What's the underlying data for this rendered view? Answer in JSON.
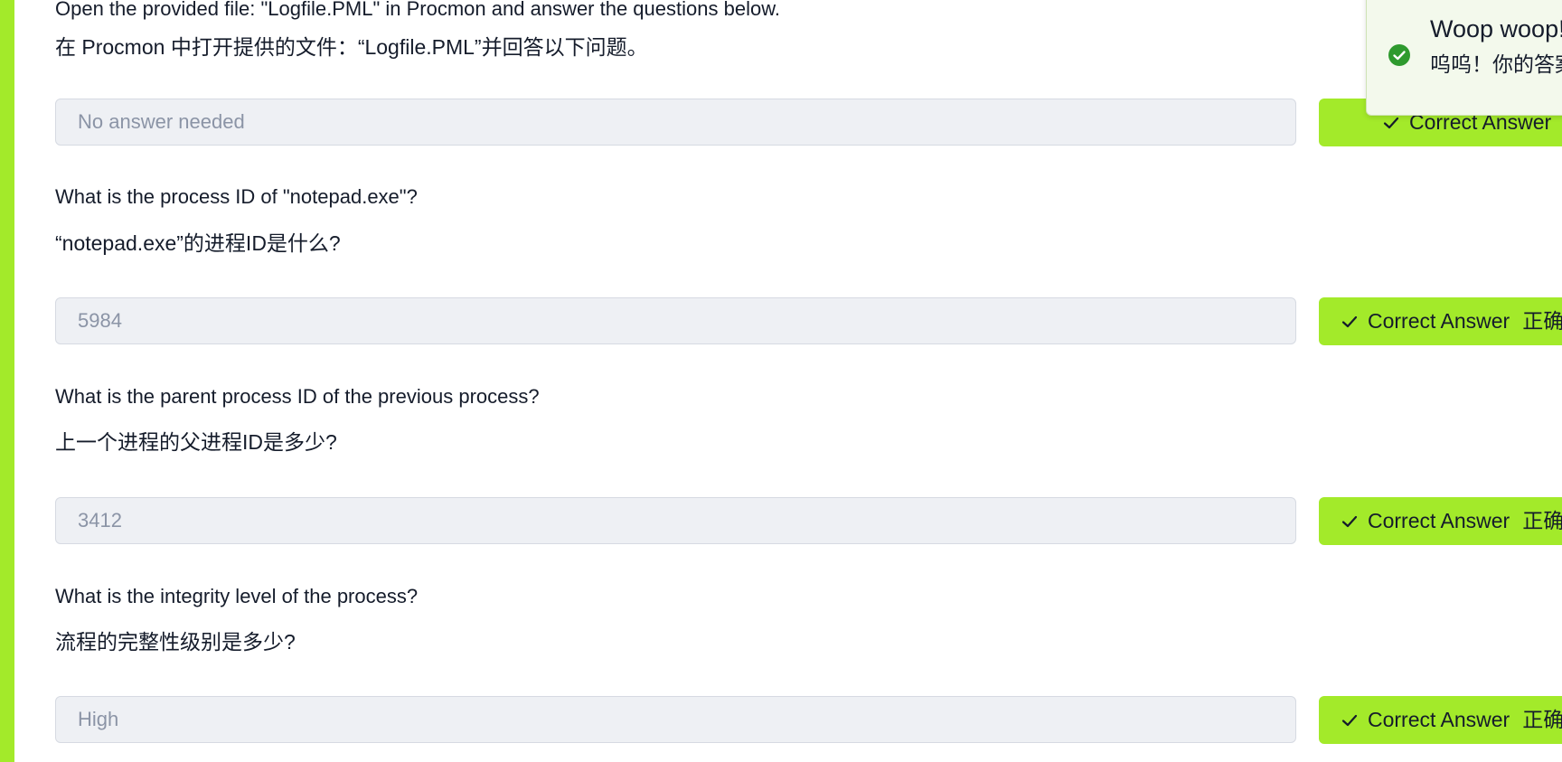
{
  "questions": [
    {
      "text_en": "Open the provided file: \"Logfile.PML\" in Procmon and answer the questions below.",
      "text_zh": "在 Procmon 中打开提供的文件：“Logfile.PML”并回答以下问题。",
      "answer": "No answer needed",
      "button_label": "Correct Answer",
      "button_label_zh": ""
    },
    {
      "text_en": "What is the process ID of \"notepad.exe\"?",
      "text_zh": "“notepad.exe”的进程ID是什么?",
      "answer": "5984",
      "button_label": "Correct Answer",
      "button_label_zh": "正确"
    },
    {
      "text_en": "What is the parent process ID of the previous process?",
      "text_zh": "上一个进程的父进程ID是多少?",
      "answer": "3412",
      "button_label": "Correct Answer",
      "button_label_zh": "正确"
    },
    {
      "text_en": "What is the integrity level of the process?",
      "text_zh": "流程的完整性级别是多少?",
      "answer": "High",
      "button_label": "Correct Answer",
      "button_label_zh": "正确"
    }
  ],
  "toast": {
    "title": "Woop woop!",
    "subtitle": "呜呜！你的答案",
    "icon": "check-circle-icon"
  },
  "colors": {
    "accent": "#a3ea2a",
    "input_bg": "#eef0f4",
    "input_text": "#8b94a6",
    "toast_icon": "#2e9a2e"
  }
}
